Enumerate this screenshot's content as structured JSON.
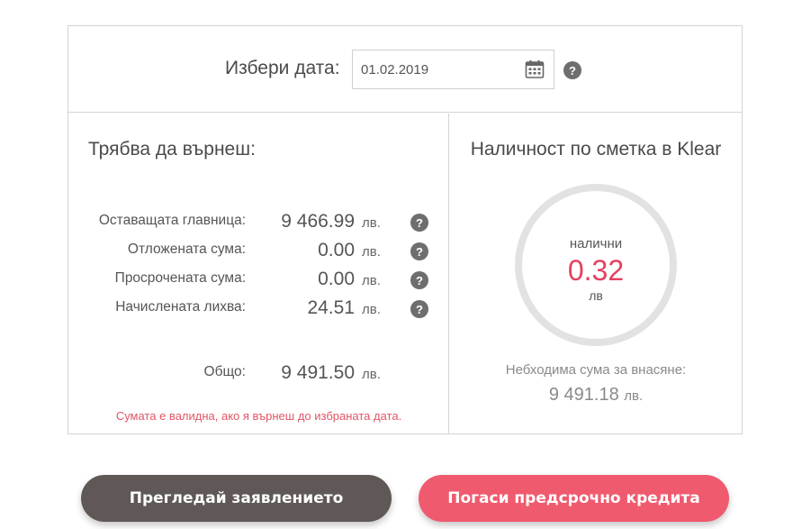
{
  "date_picker": {
    "label": "Избери дата:",
    "value": "01.02.2019",
    "help": "?"
  },
  "repay": {
    "title": "Трябва да върнеш:",
    "rows": [
      {
        "label": "Оставащата главница:",
        "value": "9 466.99",
        "unit": "лв.",
        "help": "?"
      },
      {
        "label": "Отложената сума:",
        "value": "0.00",
        "unit": "лв.",
        "help": "?"
      },
      {
        "label": "Просрочената сума:",
        "value": "0.00",
        "unit": "лв.",
        "help": "?"
      },
      {
        "label": "Начислената лихва:",
        "value": "24.51",
        "unit": "лв.",
        "help": "?"
      }
    ],
    "total": {
      "label": "Общо:",
      "value": "9 491.50",
      "unit": "лв."
    },
    "note": "Сумата е валидна, ако я върнеш до избраната дата."
  },
  "balance": {
    "title": "Наличност по сметка в Klear",
    "available_label": "налични",
    "available_value": "0.32",
    "available_unit": "лв",
    "required_label": "Небходима сума за внасяне:",
    "required_value": "9 491.18",
    "required_unit": "лв."
  },
  "buttons": {
    "review": "Прегледай заявлението",
    "repay_early": "Погаси предсрочно кредита"
  },
  "colors": {
    "accent": "#e4405f",
    "button_dark": "#5f5857",
    "button_pink": "#f05a6e",
    "note": "#e25565"
  }
}
